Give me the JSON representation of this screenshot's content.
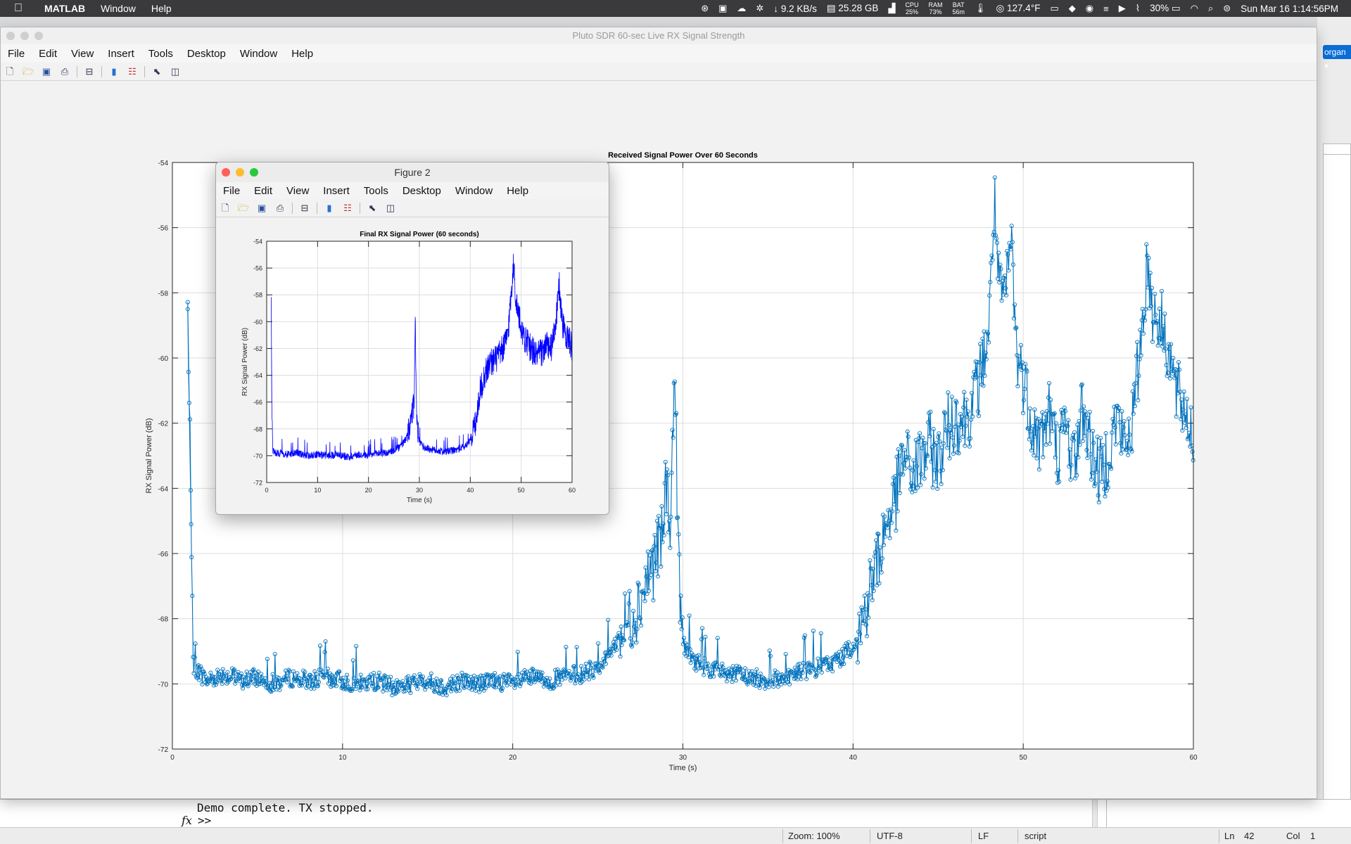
{
  "menubar": {
    "app": "MATLAB",
    "items": [
      "Window",
      "Help"
    ],
    "status": {
      "net_rate": "↓ 9.2 KB/s",
      "disk": "25.28 GB",
      "cpu_label": "CPU",
      "cpu_value": "25%",
      "ram_label": "RAM",
      "ram_value": "73%",
      "bat_label": "BAT",
      "bat_value": "56m",
      "temp": "127.4°F",
      "battery": "30%",
      "datetime": "Sun Mar 16  1:14:56PM"
    }
  },
  "fig1": {
    "title": "Pluto SDR 60-sec Live RX Signal Strength",
    "menus": [
      "File",
      "Edit",
      "View",
      "Insert",
      "Tools",
      "Desktop",
      "Window",
      "Help"
    ]
  },
  "fig2": {
    "title": "Figure 2",
    "menus": [
      "File",
      "Edit",
      "View",
      "Insert",
      "Tools",
      "Desktop",
      "Window",
      "Help"
    ]
  },
  "rightpanel": {
    "button_label": "organ ▾"
  },
  "command_window": {
    "output": "Demo complete. TX stopped.",
    "fx": "fx",
    "prompt": ">>"
  },
  "statusbar": {
    "zoom": "Zoom: 100%",
    "encoding": "UTF-8",
    "eol": "LF",
    "type": "script",
    "ln_label": "Ln",
    "ln_value": "42",
    "col_label": "Col",
    "col_value": "1"
  },
  "colors": {
    "series_main": "#0072bd",
    "series_final": "#0000ff"
  },
  "icons": [
    "apple-icon",
    "new-file-icon",
    "open-folder-icon",
    "save-icon",
    "print-icon",
    "print-preview-icon",
    "colorbar-icon",
    "legend-icon",
    "pointer-icon",
    "property-inspector-icon",
    "wifi-icon",
    "search-icon",
    "control-center-icon"
  ],
  "chart_data": [
    {
      "type": "line",
      "title": "Received Signal Power Over 60 Seconds",
      "xlabel": "Time (s)",
      "ylabel": "RX Signal Power (dB)",
      "xlim": [
        0,
        60
      ],
      "ylim": [
        -72,
        -54
      ],
      "xticks": [
        0,
        10,
        20,
        30,
        40,
        50,
        60
      ],
      "yticks": [
        -72,
        -70,
        -68,
        -66,
        -64,
        -62,
        -60,
        -58,
        -56,
        -54
      ],
      "grid": true,
      "marker": "circle",
      "series": [
        {
          "x": [
            0.9,
            1.1,
            1.2,
            2,
            3,
            4,
            5,
            6,
            7,
            8,
            9,
            10,
            11,
            12,
            13,
            14,
            15,
            16,
            17,
            18,
            19,
            20,
            21,
            22,
            23,
            24,
            25,
            25.5,
            26,
            26.5,
            27,
            27.5,
            28,
            28.3,
            28.5,
            28.8,
            29,
            29.3,
            29.5,
            29.8,
            30,
            30.5,
            31,
            32,
            33,
            34,
            35,
            36,
            37,
            38,
            39,
            39.5,
            40,
            40.5,
            41,
            41.5,
            42,
            42.5,
            43,
            43.5,
            44,
            44.5,
            45,
            45.5,
            46,
            46.5,
            47,
            47.5,
            48,
            48.3,
            48.6,
            49,
            49.3,
            49.6,
            50,
            50.5,
            51,
            51.5,
            52,
            52.5,
            53,
            53.5,
            54,
            54.5,
            55,
            55.5,
            56,
            56.5,
            57,
            57.3,
            57.6,
            58,
            58.5,
            59,
            59.5,
            60
          ],
          "y": [
            -58.5,
            -65.1,
            -69.4,
            -69.9,
            -69.7,
            -69.9,
            -69.8,
            -70.0,
            -69.8,
            -69.9,
            -69.8,
            -69.9,
            -70.0,
            -69.9,
            -70.1,
            -70.0,
            -69.9,
            -70.1,
            -69.9,
            -70.0,
            -69.9,
            -70.0,
            -69.8,
            -69.9,
            -69.8,
            -69.7,
            -69.5,
            -69.2,
            -68.8,
            -68.3,
            -67.9,
            -67.4,
            -66.6,
            -66.3,
            -65.9,
            -65.6,
            -63.8,
            -65.0,
            -60.1,
            -67.3,
            -68.7,
            -69.2,
            -69.4,
            -69.6,
            -69.7,
            -69.8,
            -69.9,
            -69.8,
            -69.6,
            -69.5,
            -69.3,
            -69.1,
            -68.8,
            -68.2,
            -67.1,
            -66.1,
            -65.0,
            -64.3,
            -63.0,
            -63.6,
            -63.1,
            -62.7,
            -63.2,
            -62.2,
            -61.8,
            -61.9,
            -61.5,
            -60.5,
            -59.0,
            -55.1,
            -58.2,
            -58.0,
            -56.2,
            -59.8,
            -60.6,
            -61.9,
            -62.6,
            -61.6,
            -62.9,
            -62.1,
            -63.2,
            -61.5,
            -62.8,
            -63.6,
            -62.9,
            -61.8,
            -62.8,
            -61.7,
            -58.9,
            -57.0,
            -58.5,
            -58.8,
            -59.6,
            -61.1,
            -61.6,
            -62.4
          ]
        }
      ]
    },
    {
      "type": "line",
      "title": "Final RX Signal Power (60 seconds)",
      "xlabel": "Time (s)",
      "ylabel": "RX Signal Power (dB)",
      "xlim": [
        0,
        60
      ],
      "ylim": [
        -72,
        -54
      ],
      "xticks": [
        0,
        10,
        20,
        30,
        40,
        50,
        60
      ],
      "yticks": [
        -72,
        -70,
        -68,
        -66,
        -64,
        -62,
        -60,
        -58,
        -56,
        -54
      ],
      "grid": true,
      "series": [
        {
          "x": [
            0.9,
            1.0,
            1.2,
            2,
            4,
            6,
            8,
            10,
            12,
            14,
            16,
            18,
            20,
            22,
            24,
            25,
            26,
            27,
            27.5,
            28,
            28.5,
            29,
            29.2,
            29.5,
            30,
            31,
            33,
            35,
            37,
            39,
            40,
            41,
            42,
            43,
            44,
            45,
            46,
            47,
            47.5,
            48,
            48.5,
            49,
            50,
            51,
            52,
            53,
            54,
            55,
            56,
            57,
            57.5,
            58,
            59,
            60
          ],
          "y": [
            -58.5,
            -66.0,
            -69.6,
            -69.8,
            -69.9,
            -69.8,
            -70.0,
            -69.9,
            -70.0,
            -69.9,
            -70.1,
            -69.9,
            -70.0,
            -69.8,
            -69.8,
            -69.6,
            -69.4,
            -69.0,
            -68.6,
            -68.2,
            -67.0,
            -66.0,
            -60.0,
            -67.5,
            -69.0,
            -69.4,
            -69.6,
            -69.7,
            -69.6,
            -69.3,
            -68.8,
            -67.5,
            -65.0,
            -63.8,
            -63.0,
            -62.8,
            -62.3,
            -61.5,
            -60.5,
            -58.0,
            -55.7,
            -58.5,
            -60.5,
            -61.5,
            -62.0,
            -62.5,
            -62.3,
            -61.8,
            -62.0,
            -59.5,
            -57.2,
            -60.0,
            -61.0,
            -62.0
          ]
        }
      ]
    }
  ]
}
